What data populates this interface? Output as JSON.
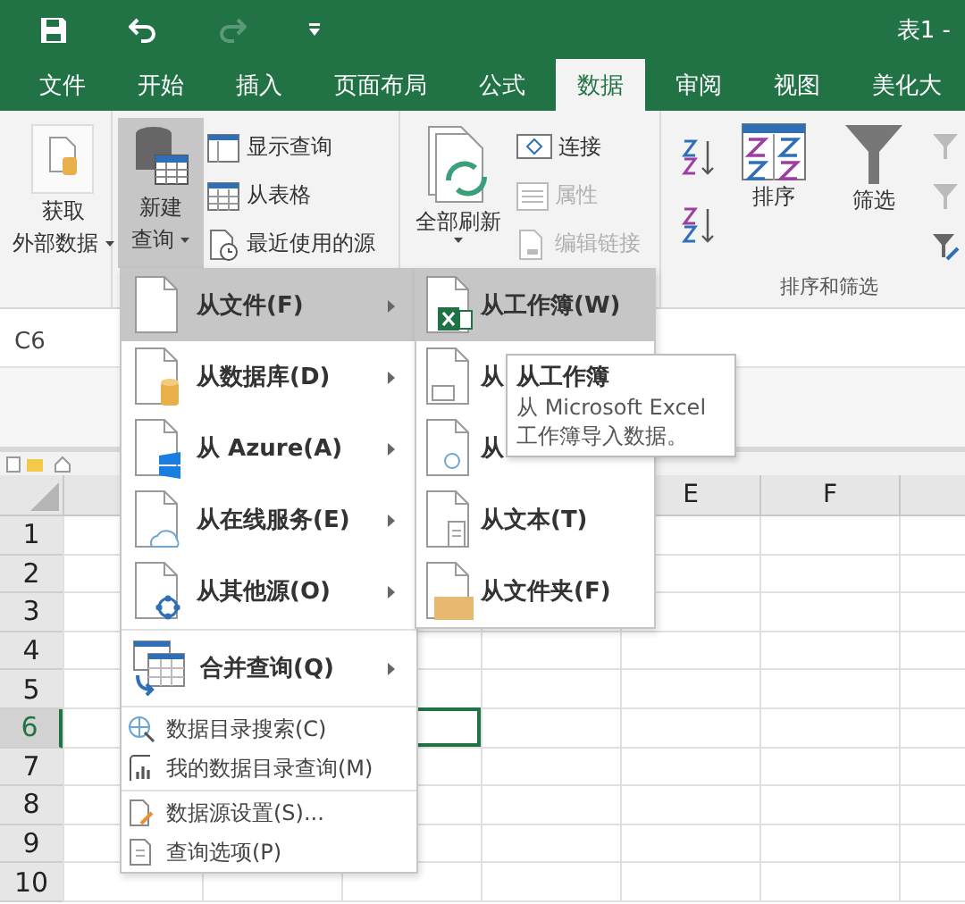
{
  "title_bar": {
    "title": "表1 -"
  },
  "tabs": [
    {
      "label": "文件",
      "selected": false
    },
    {
      "label": "开始",
      "selected": false
    },
    {
      "label": "插入",
      "selected": false
    },
    {
      "label": "页面布局",
      "selected": false
    },
    {
      "label": "公式",
      "selected": false
    },
    {
      "label": "数据",
      "selected": true
    },
    {
      "label": "审阅",
      "selected": false
    },
    {
      "label": "视图",
      "selected": false
    },
    {
      "label": "美化大",
      "selected": false
    }
  ],
  "ribbon": {
    "get_data": {
      "lines": [
        "获取",
        "外部数据"
      ]
    },
    "new_query": {
      "lines": [
        "新建",
        "查询"
      ],
      "pressed": true
    },
    "query_buttons": [
      {
        "label": "显示查询",
        "disabled": false
      },
      {
        "label": "从表格",
        "disabled": false
      },
      {
        "label": "最近使用的源",
        "disabled": false
      }
    ],
    "refresh_all": {
      "label": "全部刷新"
    },
    "connection_buttons": [
      {
        "label": "连接",
        "disabled": false
      },
      {
        "label": "属性",
        "disabled": true
      },
      {
        "label": "编辑链接",
        "disabled": true
      }
    ],
    "sort": {
      "label": "排序"
    },
    "filter": {
      "label": "筛选"
    },
    "group_label": "排序和筛选"
  },
  "name_box": {
    "value": "C6"
  },
  "grid": {
    "columns": [
      {
        "label": "E"
      },
      {
        "label": "F"
      }
    ],
    "rows": [
      {
        "label": "1",
        "selected": false
      },
      {
        "label": "2",
        "selected": false
      },
      {
        "label": "3",
        "selected": false
      },
      {
        "label": "4",
        "selected": false
      },
      {
        "label": "5",
        "selected": false
      },
      {
        "label": "6",
        "selected": true
      },
      {
        "label": "7",
        "selected": false
      },
      {
        "label": "8",
        "selected": false
      },
      {
        "label": "9",
        "selected": false
      },
      {
        "label": "10",
        "selected": false
      }
    ]
  },
  "menu": {
    "groups": [
      {
        "items": [
          {
            "label": "从文件(F)",
            "kind": "large",
            "selected": true
          },
          {
            "label": "从数据库(D)",
            "kind": "large",
            "selected": false
          },
          {
            "label": "从 Azure(A)",
            "kind": "large",
            "selected": false
          },
          {
            "label": "从在线服务(E)",
            "kind": "large",
            "selected": false
          },
          {
            "label": "从其他源(O)",
            "kind": "large",
            "selected": false
          }
        ]
      },
      {
        "items": [
          {
            "label": "合并查询(Q)",
            "kind": "large",
            "selected": false
          }
        ]
      },
      {
        "items": [
          {
            "label": "数据目录搜索(C)",
            "kind": "small",
            "selected": false
          },
          {
            "label": "我的数据目录查询(M)",
            "kind": "small",
            "selected": false
          }
        ]
      },
      {
        "items": [
          {
            "label": "数据源设置(S)...",
            "kind": "small",
            "selected": false
          },
          {
            "label": "查询选项(P)",
            "kind": "small",
            "selected": false
          }
        ]
      }
    ]
  },
  "submenu": {
    "items": [
      {
        "label": "从工作簿(W)",
        "selected": true
      },
      {
        "label": "从",
        "selected": false
      },
      {
        "label": "从",
        "selected": false
      },
      {
        "label": "从文本(T)",
        "selected": false
      },
      {
        "label": "从文件夹(F)",
        "selected": false
      }
    ]
  },
  "tooltip": {
    "title": "从工作簿",
    "text": "从 Microsoft Excel 工作簿导入数据。"
  }
}
